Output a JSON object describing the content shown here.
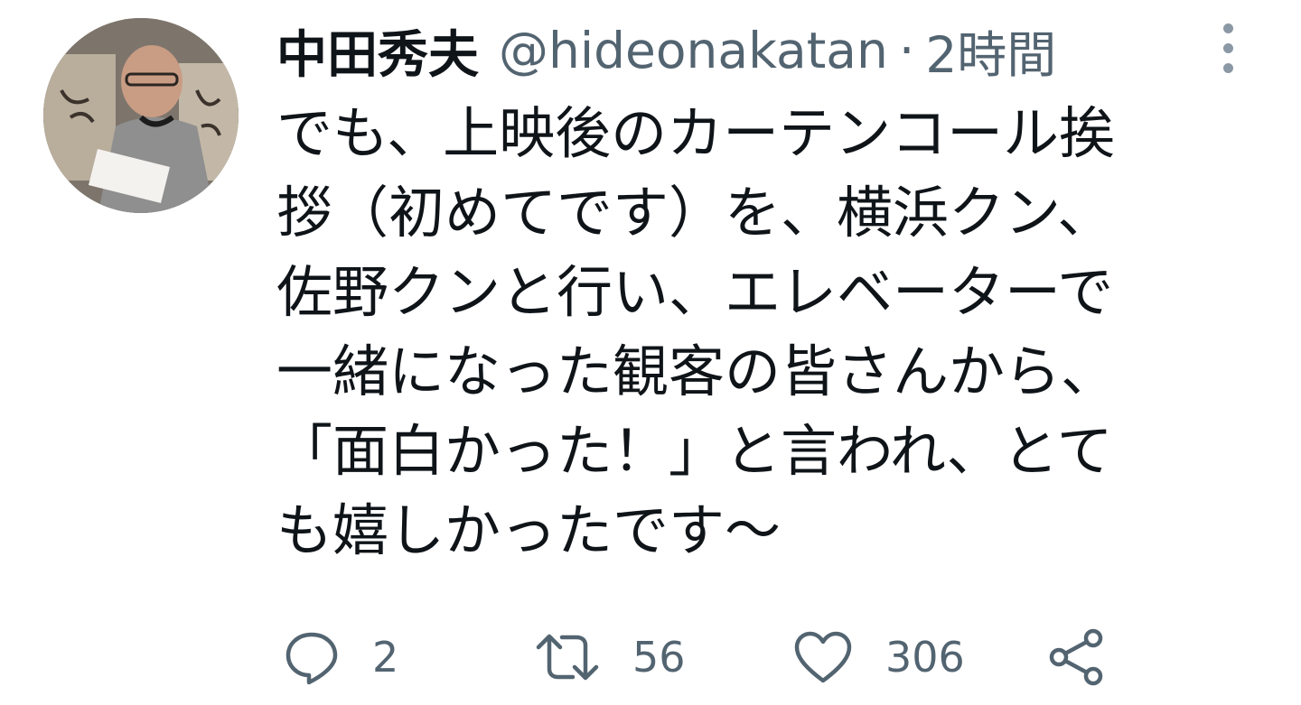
{
  "tweet": {
    "display_name": "中田秀夫",
    "handle": "@hideonakatan",
    "separator": "·",
    "time": "2時間",
    "text_lines": [
      "でも、上映後のカーテンコール挨",
      "拶（初めてです）を、横浜クン、",
      "佐野クンと行い、エレベーターで",
      "一緒になった観客の皆さんから、",
      "「面白かった！」と言われ、とて",
      "も嬉しかったです〜"
    ]
  },
  "actions": {
    "reply_count": "2",
    "retweet_count": "56",
    "like_count": "306"
  },
  "icons": {
    "avatar": "avatar-photo",
    "more": "more-vertical-icon",
    "reply": "reply-bubble-icon",
    "retweet": "retweet-icon",
    "like": "heart-icon",
    "share": "share-icon"
  },
  "colors": {
    "text_primary": "#0f1419",
    "text_secondary": "#536471"
  }
}
